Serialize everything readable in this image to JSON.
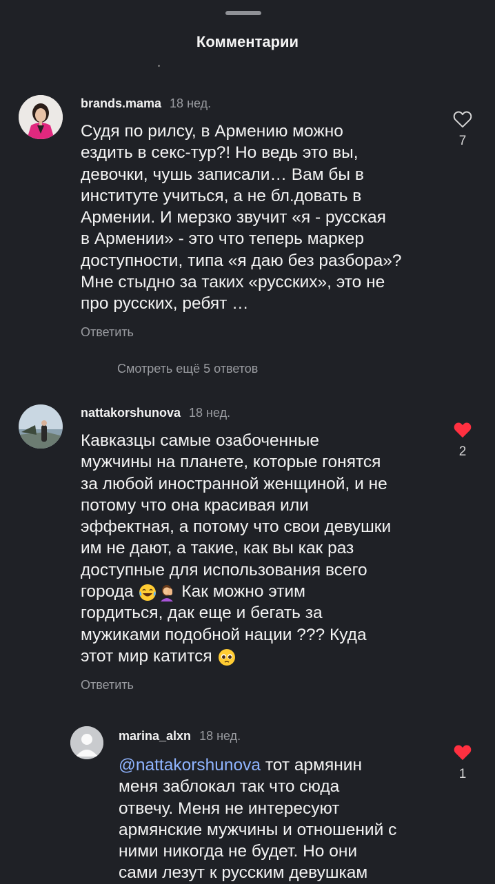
{
  "header": {
    "title": "Комментарии"
  },
  "comments": [
    {
      "username": "brands.mama",
      "time": "18 нед.",
      "lines": [
        "Судя по рилсу, в Армению можно",
        "ездить в секс-тур?! Но ведь это вы,",
        "девочки, чушь записали… Вам бы в",
        "институте учиться, а не бл.довать в",
        "Армении. И мерзко звучит «я - русская",
        "в Армении» - это что теперь маркер",
        "доступности, типа «я даю без разбора»?",
        "Мне стыдно за таких «русских», это не",
        "про русских, ребят …"
      ],
      "reply_label": "Ответить",
      "likes": "7",
      "liked": false,
      "more_replies_label": "Смотреть ещё 5 ответов"
    },
    {
      "username": "nattakorshunova",
      "time": "18 нед.",
      "lines": [
        "Кавказцы самые озабоченные",
        "мужчины на планете, которые гонятся",
        "за любой иностранной женщиной, и не",
        "потому что она красивая или",
        "эффектная, а потому что свои девушки",
        "им не дают, а такие, как вы как раз",
        "доступные для использования всего"
      ],
      "line8_start": "города",
      "line8_end": "Как можно этим",
      "lines_after": [
        "гордиться, дак еще и бегать за",
        "мужиками подобной нации ??? Куда"
      ],
      "last_line_text": "этот мир катится",
      "reply_label": "Ответить",
      "likes": "2",
      "liked": true
    },
    {
      "username": "marina_alxn",
      "time": "18 нед.",
      "mention": "@nattakorshunova",
      "first_line_rest": " тот армянин",
      "lines": [
        "меня заблокал так что сюда",
        "отвечу. Меня не интересуют",
        "армянские мужчины и отношений с",
        "ними никогда не будет. Но они",
        "сами лезут к русским девушкам"
      ],
      "likes": "1",
      "liked": true
    }
  ],
  "colors": {
    "background": "#1f2126",
    "like_red": "#ff3040",
    "muted": "#9a9ca1",
    "mention": "#8fb4ff"
  }
}
